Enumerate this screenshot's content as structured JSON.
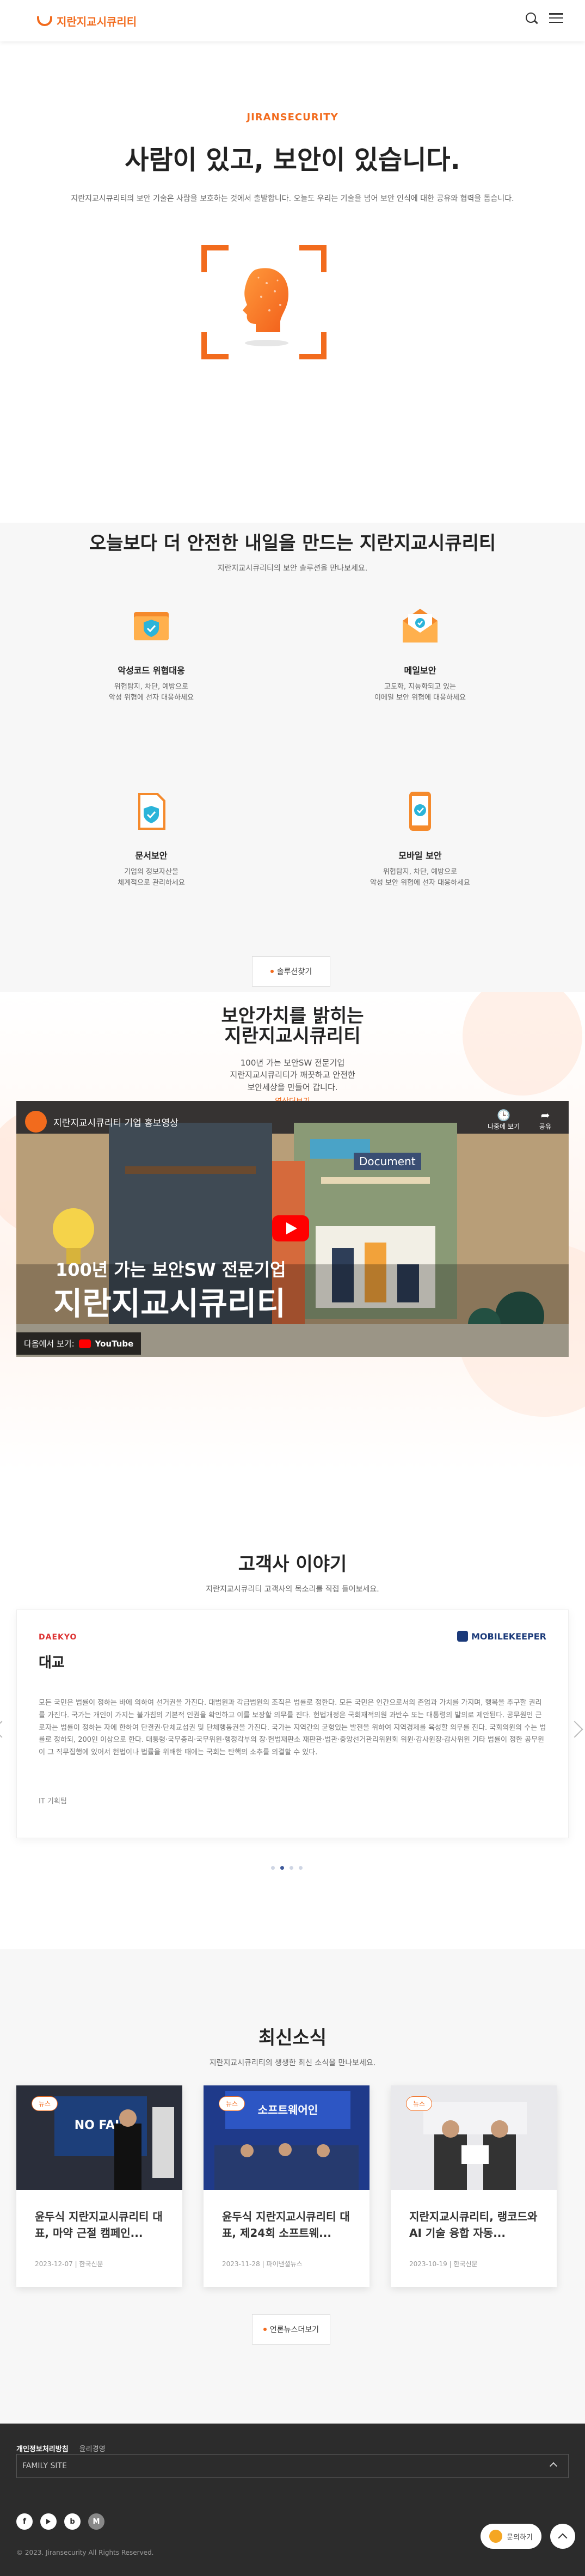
{
  "header": {
    "logo_text": "지란지교시큐리티"
  },
  "hero": {
    "eyebrow": "JIRANSECURITY",
    "title": "사람이 있고, 보안이 있습니다.",
    "lead": "지란지교시큐리티의 보안 기술은 사람을 보호하는 것에서 출발합니다. 오늘도 우리는 기술을 넘어 보안 인식에 대한 공유와 협력을 돕습니다."
  },
  "services": {
    "title": "오늘보다 더 안전한 내일을 만드는 지란지교시큐리티",
    "subtitle": "지란지교시큐리티의 보안 솔루션을 만나보세요.",
    "items": [
      {
        "title": "악성코드 위협대응",
        "desc1": "위협탐지, 차단, 예방으로",
        "desc2": "악성 위협에 선자 대응하세요"
      },
      {
        "title": "메일보안",
        "desc1": "고도화, 지능화되고 있는",
        "desc2": "이메일 보안 위협에 대응하세요"
      },
      {
        "title": "문서보안",
        "desc1": "기업의 정보자산을",
        "desc2": "체계적으로 관리하세요"
      },
      {
        "title": "모바일 보안",
        "desc1": "위협탐지, 차단, 예방으로",
        "desc2": "악성 보안 위협에 선자 대응하세요"
      }
    ],
    "more_label": "솔루션찾기"
  },
  "value": {
    "title_line1": "보안가치를 밝히는",
    "title_line2": "지란지교시큐리티",
    "desc1": "100년 가는 보안SW 전문기업",
    "desc2": "지란지교시큐리티가 깨끗하고 안전한",
    "desc3": "보안세상을 만들어 갑니다.",
    "link": "영상더보기"
  },
  "video": {
    "title": "지란지교시큐리티 기업 홍보영상",
    "watch_later": "나중에 보기",
    "share": "공유",
    "overlay_line1": "100년 가는 보안SW 전문기업",
    "overlay_line2": "지란지교시큐리티",
    "watch_on": "다음에서 보기:",
    "youtube": "YouTube",
    "doc_label": "Document"
  },
  "stories": {
    "title": "고객사 이야기",
    "subtitle": "지란지교시큐리티 고객사의 목소리를 직접 들어보세요.",
    "client_logo": "DAEKYO",
    "product_logo": "MOBILEKEEPER",
    "card_title": "대교",
    "body": "모든 국민은 법률이 정하는 바에 의하여 선거권을 가진다. 대법원과 각급법원의 조직은 법률로 정한다. 모든 국민은 인간으로서의 존엄과 가치를 가지며, 행복을 추구할 권리를 가진다. 국가는 개인이 가지는 불가침의 기본적 인권을 확인하고 이를 보장할 의무를 진다. 헌법개정은 국회재적의원 과반수 또는 대통령의 발의로 제안된다. 공무원인 근로자는 법률이 정하는 자에 한하여 단결권·단체교섭권 및 단체행동권을 가진다. 국가는 지역간의 균형있는 발전을 위하여 지역경제를 육성할 의무를 진다. 국회의원의 수는 법률로 정하되, 200인 이상으로 한다. 대통령·국무총리·국무위원·행정각부의 장·헌법재판소 재판관·법관·중앙선거관리위원회 위원·감사원장·감사위원 기타 법률이 정한 공무원이 그 직무집행에 있어서 헌법이나 법률을 위배한 때에는 국회는 탄핵의 소추를 의결할 수 있다.",
    "tag": "IT 기획팀"
  },
  "news": {
    "title": "최신소식",
    "subtitle": "지란지교시큐리티의 생생한 최신 소식을 만나보세요.",
    "items": [
      {
        "tag": "뉴스",
        "title": "윤두식 지란지교시큐리티 대표, 마약 근절 캠페인...",
        "date": "2023-12-07",
        "source": "한국신문"
      },
      {
        "tag": "뉴스",
        "title": "윤두식 지란지교시큐리티 대표, 제24회 소프트웨...",
        "date": "2023-11-28",
        "source": "파이낸셜뉴스"
      },
      {
        "tag": "뉴스",
        "title": "지란지교시큐리티, 랭코드와 AI 기술 융합 자동...",
        "date": "2023-10-19",
        "source": "한국신문"
      }
    ],
    "more_label": "언론뉴스더보기",
    "img2_text": "소프트웨어인"
  },
  "footer": {
    "privacy": "개인정보처리방침",
    "ethics": "윤리경영",
    "family_site": "FAMILY SITE",
    "copyright": "© 2023. Jiransecurity All Rights Reserved.",
    "contact": "문의하기"
  },
  "colors": {
    "accent": "#f26b1d",
    "dark": "#2c2c2c"
  }
}
